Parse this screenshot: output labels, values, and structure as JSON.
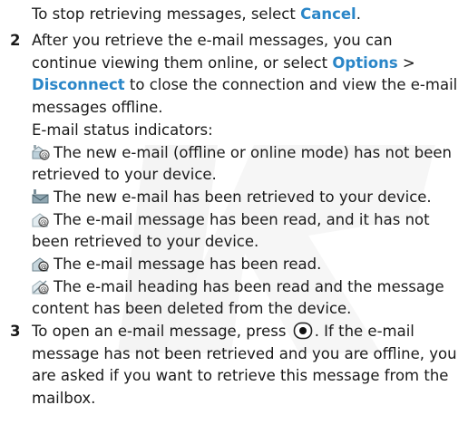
{
  "intro": {
    "text": "To stop retrieving messages, select ",
    "link": "Cancel",
    "end": "."
  },
  "step2": {
    "number": "2",
    "text1": "After you retrieve the e-mail messages, you can continue viewing them online, or select ",
    "options": "Options",
    "sep": " > ",
    "disconnect": "Disconnect",
    "text2": " to close the connection and view the e-mail messages offline.",
    "indicators_heading": "E-mail status indicators:",
    "indicators": [
      {
        "icon": "new-email-not-retrieved-icon",
        "text": "The new e-mail (offline or online mode) has not been retrieved to your device."
      },
      {
        "icon": "new-email-retrieved-icon",
        "text": "The new e-mail has been retrieved to your device."
      },
      {
        "icon": "email-read-not-retrieved-icon",
        "text": "The e-mail message has been read, and it has not been retrieved to your device."
      },
      {
        "icon": "email-read-icon",
        "text": "The e-mail message has been read."
      },
      {
        "icon": "email-heading-read-content-deleted-icon",
        "text": "The e-mail heading has been read and the message content has been deleted from the device."
      }
    ]
  },
  "step3": {
    "number": "3",
    "text1": "To open an e-mail message, press ",
    "key_icon": "joystick-select-key-icon",
    "text2": ". If the e-mail message has not been retrieved and you are offline, you are asked if you want to retrieve this message from the mailbox."
  }
}
